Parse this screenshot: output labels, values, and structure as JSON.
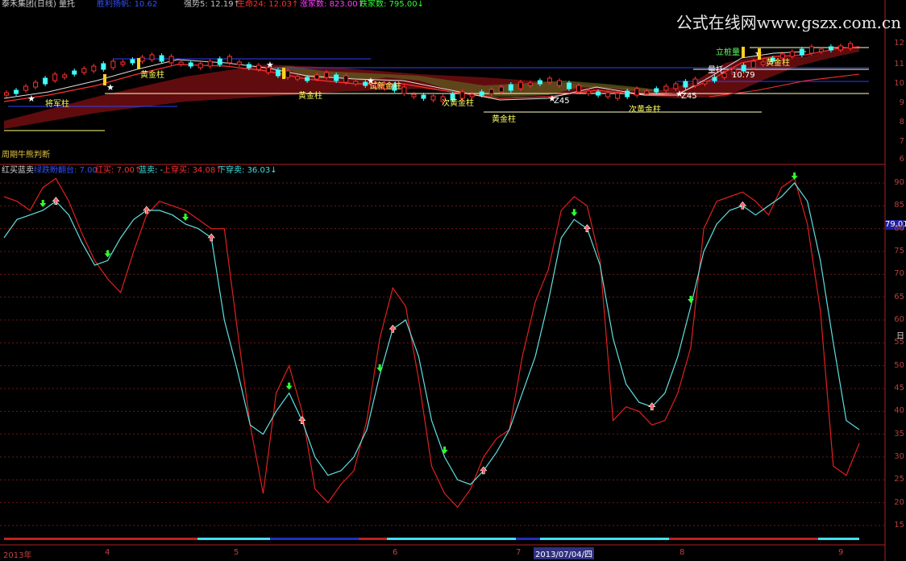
{
  "top_panel": {
    "title": "泰禾集团(日线)",
    "title_suffix": "量托",
    "items": [
      {
        "label": "胜利扬帆",
        "value": "10.62",
        "color": "#3050ff"
      },
      {
        "label": "强势5",
        "value": "12.19",
        "color": "#c0c0c0"
      },
      {
        "label": "生命24",
        "value": "12.03",
        "color": "#ff3030"
      },
      {
        "label": "涨家数",
        "value": "823.00",
        "color": "#ff40ff"
      },
      {
        "label": "跌家数",
        "value": "795.00",
        "color": "#30ff30"
      }
    ],
    "bottom_note": "周期牛熊判断"
  },
  "bottom_panel": {
    "title": "红买蓝卖",
    "items": [
      {
        "label": "绿跌盼翻台",
        "value": "7.00",
        "color": "#3050ff"
      },
      {
        "label": "红买",
        "value": "7.00",
        "color": "#ff3030",
        "arrow": "↑"
      },
      {
        "label": "蓝卖",
        "value": "-",
        "color": "#40e0e0"
      },
      {
        "label": "上穿买",
        "value": "34.08",
        "color": "#ff3030",
        "arrow": "↑"
      },
      {
        "label": "下穿卖",
        "value": "36.03",
        "color": "#40e0e0",
        "arrow": "↓"
      }
    ],
    "current_value": "79.01"
  },
  "watermark": "公式在线网www.gszx.com.cn",
  "annotations": {
    "huangjinzhu": "黄金柱",
    "cihuangjinzhu": "次黄金柱",
    "jiangjunzhu": "将军柱",
    "shiwujinzhu": "试新金柱",
    "lijiliang": "立桩量",
    "beituo": "量托",
    "z45": "Z45",
    "price_1079": "10.79"
  },
  "price_axis": [
    "12",
    "11",
    "10",
    "9",
    "8",
    "7",
    "6"
  ],
  "osc_axis": [
    "90",
    "85",
    "80",
    "75",
    "70",
    "65",
    "60",
    "55",
    "50",
    "45",
    "40",
    "35",
    "30",
    "25",
    "20",
    "15"
  ],
  "right_edge_label": "日",
  "date_axis": {
    "labels": [
      "2013年",
      "4",
      "5",
      "6",
      "7",
      "8",
      "9"
    ],
    "highlight": "2013/07/04/四"
  },
  "chart_data": {
    "type": "line",
    "title": "红买蓝卖",
    "ylim": [
      12,
      93
    ],
    "series": [
      {
        "name": "红线",
        "color": "#e02020",
        "values": [
          87,
          86,
          84,
          89,
          91,
          86,
          79,
          73,
          69,
          66,
          75,
          83,
          86,
          85,
          84,
          82,
          80,
          80,
          58,
          37,
          22,
          44,
          50,
          40,
          23,
          20,
          24,
          27,
          38,
          56,
          67,
          63,
          47,
          28,
          22,
          19,
          23,
          30,
          34,
          36,
          52,
          64,
          71,
          84,
          87,
          85,
          73,
          38,
          41,
          40,
          37,
          38,
          44,
          54,
          80,
          86,
          87,
          88,
          86,
          83,
          89,
          91,
          81,
          62,
          28,
          26,
          33
        ]
      },
      {
        "name": "蓝线",
        "color": "#60e0e0",
        "values": [
          78,
          82,
          83,
          84,
          86,
          83,
          77,
          72,
          73,
          78,
          82,
          84,
          84,
          83,
          81,
          80,
          78,
          60,
          49,
          37,
          35,
          40,
          44,
          38,
          30,
          26,
          27,
          30,
          36,
          48,
          58,
          60,
          52,
          38,
          30,
          25,
          24,
          27,
          31,
          36,
          44,
          52,
          64,
          78,
          82,
          80,
          72,
          56,
          46,
          42,
          41,
          44,
          52,
          63,
          75,
          81,
          84,
          85,
          83,
          85,
          87,
          90,
          86,
          73,
          55,
          38,
          36
        ]
      }
    ],
    "buy_signals_red_up": [
      4,
      11,
      16,
      23,
      30,
      37,
      45,
      50,
      57
    ],
    "sell_signals_green_down": [
      3,
      8,
      14,
      22,
      29,
      34,
      44,
      53,
      61
    ]
  }
}
